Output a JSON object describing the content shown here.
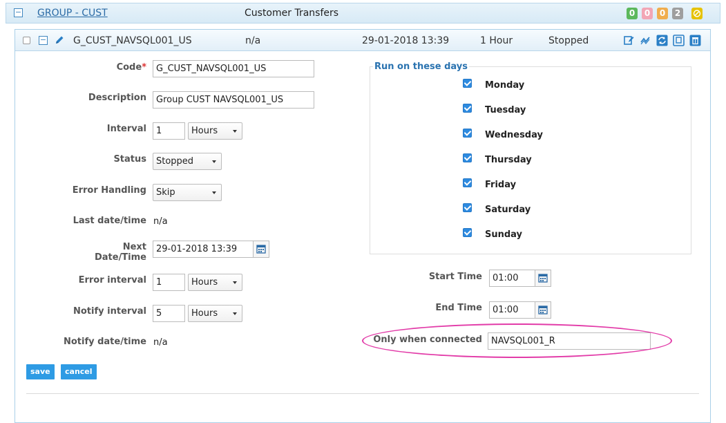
{
  "group": {
    "link": "GROUP - CUST",
    "title": "Customer Transfers",
    "badges": [
      {
        "value": "0",
        "color": "#5cb85c"
      },
      {
        "value": "0",
        "color": "#f2a6b5"
      },
      {
        "value": "0",
        "color": "#f0ad4e"
      },
      {
        "value": "2",
        "color": "#9e9e9e"
      }
    ],
    "toggle": "−"
  },
  "item": {
    "toggle": "−",
    "code": "G_CUST_NAVSQL001_US",
    "last": "n/a",
    "next": "29-01-2018 13:39",
    "interval": "1 Hour",
    "status": "Stopped"
  },
  "form": {
    "code_label": "Code",
    "code_required": "*",
    "code_value": "G_CUST_NAVSQL001_US",
    "description_label": "Description",
    "description_value": "Group CUST NAVSQL001_US",
    "interval_label": "Interval",
    "interval_value": "1",
    "interval_unit": "Hours",
    "status_label": "Status",
    "status_value": "Stopped",
    "error_handling_label": "Error Handling",
    "error_handling_value": "Skip",
    "last_label": "Last date/time",
    "last_value": "n/a",
    "next_label": "Next Date/Time",
    "next_value": "29-01-2018 13:39",
    "error_interval_label": "Error interval",
    "error_interval_value": "1",
    "error_interval_unit": "Hours",
    "notify_interval_label": "Notify interval",
    "notify_interval_value": "5",
    "notify_interval_unit": "Hours",
    "notify_label": "Notify date/time",
    "notify_value": "n/a",
    "save": "save",
    "cancel": "cancel"
  },
  "days": {
    "legend": "Run on these days",
    "items": [
      {
        "label": "Monday",
        "checked": true
      },
      {
        "label": "Tuesday",
        "checked": true
      },
      {
        "label": "Wednesday",
        "checked": true
      },
      {
        "label": "Thursday",
        "checked": true
      },
      {
        "label": "Friday",
        "checked": true
      },
      {
        "label": "Saturday",
        "checked": true
      },
      {
        "label": "Sunday",
        "checked": true
      }
    ]
  },
  "schedule": {
    "start_label": "Start Time",
    "start_value": "01:00",
    "end_label": "End Time",
    "end_value": "01:00",
    "connected_label": "Only when connected",
    "connected_value": "NAVSQL001_R"
  }
}
